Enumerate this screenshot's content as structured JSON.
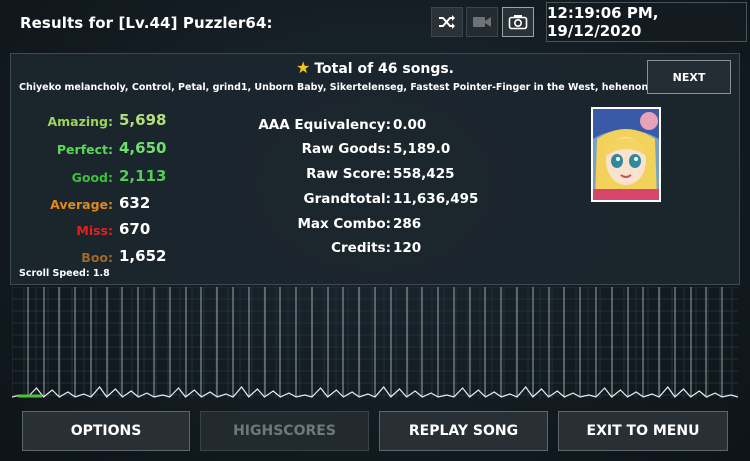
{
  "header": {
    "title": "Results for [Lv.44] Puzzler64:",
    "clock": "12:19:06 PM, 19/12/2020",
    "icons": [
      "shuffle-icon",
      "video-camera-icon",
      "camera-icon"
    ]
  },
  "summary": {
    "total": "Total of 46 songs.",
    "songs": "Chiyeko melancholy, Control, Petal, grind1, Unborn Baby, Sikertelenseg, Fastest Pointer-Finger in the West, hehenonomohe, i",
    "next_label": "NEXT"
  },
  "judgements": [
    {
      "label": "Amazing:",
      "value": "5,698",
      "color": "#9bd65a"
    },
    {
      "label": "Perfect:",
      "value": "4,650",
      "color": "#57d957"
    },
    {
      "label": "Good:",
      "value": "2,113",
      "color": "#3fbf3f"
    },
    {
      "label": "Average:",
      "value": "632",
      "color": "#e08a1e"
    },
    {
      "label": "Miss:",
      "value": "670",
      "color": "#e02222"
    },
    {
      "label": "Boo:",
      "value": "1,652",
      "color": "#9c6a2a"
    }
  ],
  "stats": [
    {
      "label": "AAA Equivalency:",
      "value": "0.00"
    },
    {
      "label": "Raw Goods:",
      "value": "5,189.0"
    },
    {
      "label": "Raw Score:",
      "value": "558,425"
    },
    {
      "label": "Grandtotal:",
      "value": "11,636,495"
    },
    {
      "label": "Max Combo:",
      "value": "286"
    },
    {
      "label": "Credits:",
      "value": "120"
    }
  ],
  "scroll_speed": "Scroll Speed: 1.8",
  "buttons": {
    "options": "OPTIONS",
    "highscores": "HIGHSCORES",
    "replay": "REPLAY SONG",
    "exit": "EXIT TO MENU"
  },
  "colors": {
    "accent_green": "#4fbf3a",
    "panel_border": "#3e4950"
  }
}
